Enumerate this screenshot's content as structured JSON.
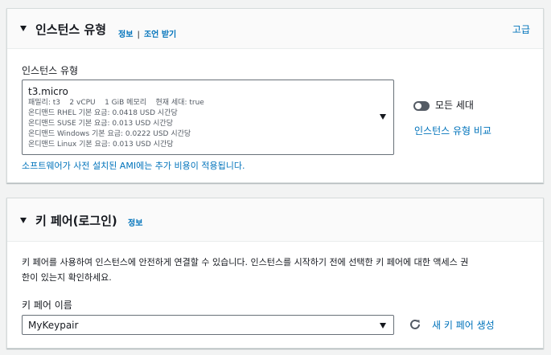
{
  "instance_type_panel": {
    "title": "인스턴스 유형",
    "info_link": "정보",
    "separator": "|",
    "advice_link": "조언 받기",
    "advanced_link": "고급",
    "field_label": "인스턴스 유형",
    "selected": {
      "name": "t3.micro",
      "specs": "패밀리: t3    2 vCPU    1 GiB 메모리    현재 세대: true",
      "pricing": [
        "온디맨드 RHEL 기본 요금: 0.0418 USD 시간당",
        "온디맨드 SUSE 기본 요금: 0.013 USD 시간당",
        "온디맨드 Windows 기본 요금: 0.0222 USD 시간당",
        "온디맨드 Linux 기본 요금: 0.013 USD 시간당"
      ]
    },
    "all_generations_label": "모든 세대",
    "all_generations_on": false,
    "compare_link": "인스턴스 유형 비교",
    "ami_note": "소프트웨어가 사전 설치된 AMI에는 추가 비용이 적용됩니다."
  },
  "key_pair_panel": {
    "title": "키 페어(로그인)",
    "info_link": "정보",
    "description_line1": "키 페어를 사용하여 인스턴스에 안전하게 연결할 수 있습니다. 인스턴스를 시작하기 전에 선택한 키 페어에 대한 액세스 권",
    "description_line2": "한이 있는지 확인하세요.",
    "field_label": "키 페어 이름",
    "selected": "MyKeypair",
    "create_link": "새 키 페어 생성"
  },
  "colors": {
    "link": "#0073bb",
    "border": "#687078",
    "page_bg": "#f2f3f3"
  }
}
